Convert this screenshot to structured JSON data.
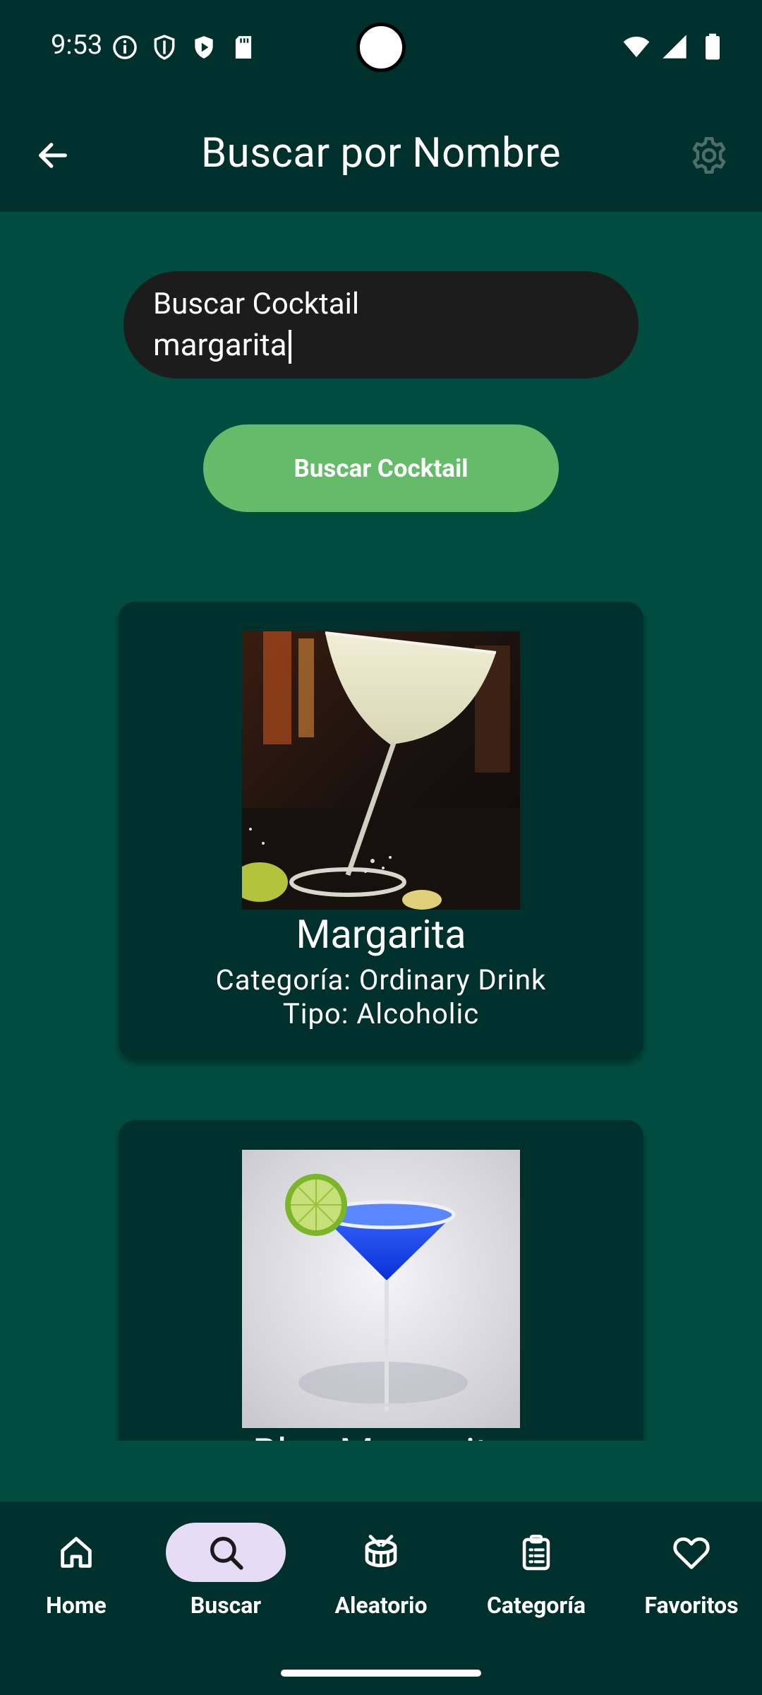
{
  "status_bar": {
    "time": "9:53"
  },
  "app_bar": {
    "title": "Buscar por Nombre"
  },
  "search": {
    "label": "Buscar Cocktail",
    "value": "margarita",
    "button_label": "Buscar Cocktail"
  },
  "results": [
    {
      "name": "Margarita",
      "category": "Categoría: Ordinary Drink",
      "type": "Tipo: Alcoholic"
    },
    {
      "name": "Blue Margarita",
      "category": "",
      "type": ""
    }
  ],
  "nav": {
    "items": [
      {
        "label": "Home",
        "icon": "home-icon"
      },
      {
        "label": "Buscar",
        "icon": "search-icon",
        "active": true
      },
      {
        "label": "Aleatorio",
        "icon": "drum-icon"
      },
      {
        "label": "Categoría",
        "icon": "clipboard-icon"
      },
      {
        "label": "Favoritos",
        "icon": "heart-icon"
      }
    ]
  },
  "colors": {
    "background": "#004d40",
    "bars": "#00302b",
    "button": "#66bb6a",
    "nav_active_pill": "#e6dcf7"
  }
}
